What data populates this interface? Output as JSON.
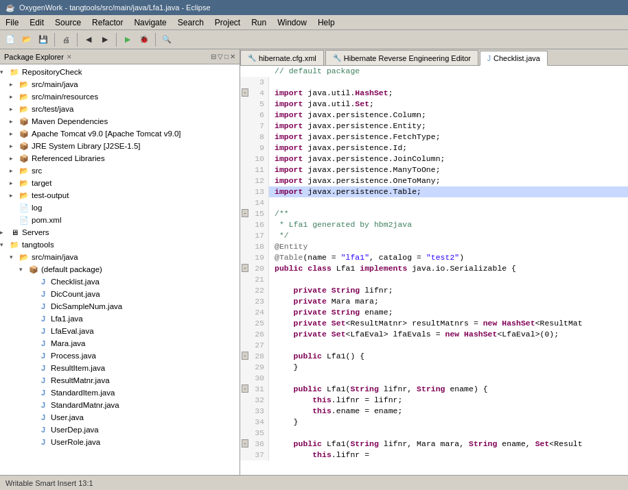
{
  "titleBar": {
    "title": "OxygenWork - tangtools/src/main/java/Lfa1.java - Eclipse",
    "icon": "☕"
  },
  "menuBar": {
    "items": [
      "File",
      "Edit",
      "Source",
      "Refactor",
      "Navigate",
      "Search",
      "Project",
      "Run",
      "Window",
      "Help"
    ]
  },
  "packageExplorer": {
    "header": "Package Explorer",
    "tree": [
      {
        "id": "repo-check",
        "label": "RepositoryCheck",
        "indent": 0,
        "type": "project",
        "expanded": true,
        "icon": "📁"
      },
      {
        "id": "src-main-java",
        "label": "src/main/java",
        "indent": 1,
        "type": "folder",
        "expanded": false,
        "icon": "📂"
      },
      {
        "id": "src-main-res",
        "label": "src/main/resources",
        "indent": 1,
        "type": "folder",
        "expanded": false,
        "icon": "📂"
      },
      {
        "id": "src-test-java",
        "label": "src/test/java",
        "indent": 1,
        "type": "folder",
        "expanded": false,
        "icon": "📂"
      },
      {
        "id": "maven-deps",
        "label": "Maven Dependencies",
        "indent": 1,
        "type": "lib",
        "expanded": false,
        "icon": "📦"
      },
      {
        "id": "tomcat",
        "label": "Apache Tomcat v9.0 [Apache Tomcat v9.0]",
        "indent": 1,
        "type": "lib",
        "expanded": false,
        "icon": "📦"
      },
      {
        "id": "jre",
        "label": "JRE System Library [J2SE-1.5]",
        "indent": 1,
        "type": "lib",
        "expanded": false,
        "icon": "📦"
      },
      {
        "id": "ref-libs",
        "label": "Referenced Libraries",
        "indent": 1,
        "type": "lib",
        "expanded": false,
        "icon": "📦"
      },
      {
        "id": "src",
        "label": "src",
        "indent": 1,
        "type": "folder",
        "expanded": false,
        "icon": "📂"
      },
      {
        "id": "target",
        "label": "target",
        "indent": 1,
        "type": "folder",
        "expanded": false,
        "icon": "📂"
      },
      {
        "id": "test-output",
        "label": "test-output",
        "indent": 1,
        "type": "folder",
        "expanded": false,
        "icon": "📂"
      },
      {
        "id": "log",
        "label": "log",
        "indent": 1,
        "type": "file",
        "icon": "📄"
      },
      {
        "id": "pom",
        "label": "pom.xml",
        "indent": 1,
        "type": "file",
        "icon": "📄"
      },
      {
        "id": "servers",
        "label": "Servers",
        "indent": 0,
        "type": "project",
        "expanded": false,
        "icon": "🖥"
      },
      {
        "id": "tangtools",
        "label": "tangtools",
        "indent": 0,
        "type": "project",
        "expanded": true,
        "icon": "📁"
      },
      {
        "id": "tang-src-main-java",
        "label": "src/main/java",
        "indent": 1,
        "type": "folder",
        "expanded": true,
        "icon": "📂"
      },
      {
        "id": "tang-default-pkg",
        "label": "(default package)",
        "indent": 2,
        "type": "package",
        "expanded": true,
        "icon": "📦"
      },
      {
        "id": "Checklist",
        "label": "Checklist.java",
        "indent": 3,
        "type": "java",
        "icon": "J"
      },
      {
        "id": "DicCount",
        "label": "DicCount.java",
        "indent": 3,
        "type": "java",
        "icon": "J"
      },
      {
        "id": "DicSampleNum",
        "label": "DicSampleNum.java",
        "indent": 3,
        "type": "java",
        "icon": "J"
      },
      {
        "id": "Lfa1",
        "label": "Lfa1.java",
        "indent": 3,
        "type": "java",
        "icon": "J"
      },
      {
        "id": "LfaEval",
        "label": "LfaEval.java",
        "indent": 3,
        "type": "java",
        "icon": "J"
      },
      {
        "id": "Mara",
        "label": "Mara.java",
        "indent": 3,
        "type": "java",
        "icon": "J"
      },
      {
        "id": "Process",
        "label": "Process.java",
        "indent": 3,
        "type": "java",
        "icon": "J"
      },
      {
        "id": "ResultItem",
        "label": "ResultItem.java",
        "indent": 3,
        "type": "java",
        "icon": "J"
      },
      {
        "id": "ResultMatnr",
        "label": "ResultMatnr.java",
        "indent": 3,
        "type": "java",
        "icon": "J"
      },
      {
        "id": "StandardItem",
        "label": "StandardItem.java",
        "indent": 3,
        "type": "java",
        "icon": "J"
      },
      {
        "id": "StandardMatnr",
        "label": "StandardMatnr.java",
        "indent": 3,
        "type": "java",
        "icon": "J"
      },
      {
        "id": "User",
        "label": "User.java",
        "indent": 3,
        "type": "java",
        "icon": "J"
      },
      {
        "id": "UserDep",
        "label": "UserDep.java",
        "indent": 3,
        "type": "java",
        "icon": "J"
      },
      {
        "id": "UserRole",
        "label": "UserRole.java",
        "indent": 3,
        "type": "java",
        "icon": "J"
      }
    ]
  },
  "editorTabs": [
    {
      "id": "hibernate-cfg",
      "label": "hibernate.cfg.xml",
      "active": false,
      "icon": "🔧"
    },
    {
      "id": "hibernate-rev",
      "label": "Hibernate Reverse Engineering Editor",
      "active": false,
      "icon": "🔧"
    },
    {
      "id": "checklist-java",
      "label": "Checklist.java",
      "active": true,
      "icon": "J"
    }
  ],
  "codeLines": [
    {
      "num": "",
      "content": "// default package",
      "fold": false,
      "foldType": "",
      "highlighted": false
    },
    {
      "num": "3",
      "content": "",
      "fold": false,
      "foldType": "",
      "highlighted": false
    },
    {
      "num": "4",
      "content": "import java.util.HashSet;",
      "fold": true,
      "foldType": "-",
      "highlighted": false
    },
    {
      "num": "5",
      "content": "import java.util.Set;",
      "fold": false,
      "foldType": "",
      "highlighted": false
    },
    {
      "num": "6",
      "content": "import javax.persistence.Column;",
      "fold": false,
      "foldType": "",
      "highlighted": false
    },
    {
      "num": "7",
      "content": "import javax.persistence.Entity;",
      "fold": false,
      "foldType": "",
      "highlighted": false
    },
    {
      "num": "8",
      "content": "import javax.persistence.FetchType;",
      "fold": false,
      "foldType": "",
      "highlighted": false
    },
    {
      "num": "9",
      "content": "import javax.persistence.Id;",
      "fold": false,
      "foldType": "",
      "highlighted": false
    },
    {
      "num": "10",
      "content": "import javax.persistence.JoinColumn;",
      "fold": false,
      "foldType": "",
      "highlighted": false
    },
    {
      "num": "11",
      "content": "import javax.persistence.ManyToOne;",
      "fold": false,
      "foldType": "",
      "highlighted": false
    },
    {
      "num": "12",
      "content": "import javax.persistence.OneToMany;",
      "fold": false,
      "foldType": "",
      "highlighted": false
    },
    {
      "num": "13",
      "content": "import javax.persistence.Table;",
      "fold": false,
      "foldType": "",
      "highlighted": true
    },
    {
      "num": "14",
      "content": "",
      "fold": false,
      "foldType": "",
      "highlighted": false
    },
    {
      "num": "15",
      "content": "/**",
      "fold": true,
      "foldType": "-",
      "highlighted": false
    },
    {
      "num": "16",
      "content": " * Lfa1 generated by hbm2java",
      "fold": false,
      "foldType": "",
      "highlighted": false
    },
    {
      "num": "17",
      "content": " */",
      "fold": false,
      "foldType": "",
      "highlighted": false
    },
    {
      "num": "18",
      "content": "@Entity",
      "fold": false,
      "foldType": "",
      "highlighted": false
    },
    {
      "num": "19",
      "content": "@Table(name = \"lfa1\", catalog = \"test2\")",
      "fold": false,
      "foldType": "",
      "highlighted": false
    },
    {
      "num": "20",
      "content": "public class Lfa1 implements java.io.Serializable {",
      "fold": true,
      "foldType": "-",
      "highlighted": false
    },
    {
      "num": "21",
      "content": "",
      "fold": false,
      "foldType": "",
      "highlighted": false
    },
    {
      "num": "22",
      "content": "    private String lifnr;",
      "fold": false,
      "foldType": "",
      "highlighted": false
    },
    {
      "num": "23",
      "content": "    private Mara mara;",
      "fold": false,
      "foldType": "",
      "highlighted": false
    },
    {
      "num": "24",
      "content": "    private String ename;",
      "fold": false,
      "foldType": "",
      "highlighted": false
    },
    {
      "num": "25",
      "content": "    private Set<ResultMatnr> resultMatnrs = new HashSet<ResultMat",
      "fold": false,
      "foldType": "",
      "highlighted": false
    },
    {
      "num": "26",
      "content": "    private Set<LfaEval> lfaEvals = new HashSet<LfaEval>(0);",
      "fold": false,
      "foldType": "",
      "highlighted": false
    },
    {
      "num": "27",
      "content": "",
      "fold": false,
      "foldType": "",
      "highlighted": false
    },
    {
      "num": "28",
      "content": "    public Lfa1() {",
      "fold": true,
      "foldType": "-",
      "highlighted": false
    },
    {
      "num": "29",
      "content": "    }",
      "fold": false,
      "foldType": "",
      "highlighted": false
    },
    {
      "num": "30",
      "content": "",
      "fold": false,
      "foldType": "",
      "highlighted": false
    },
    {
      "num": "31",
      "content": "    public Lfa1(String lifnr, String ename) {",
      "fold": true,
      "foldType": "-",
      "highlighted": false
    },
    {
      "num": "32",
      "content": "        this.lifnr = lifnr;",
      "fold": false,
      "foldType": "",
      "highlighted": false
    },
    {
      "num": "33",
      "content": "        this.ename = ename;",
      "fold": false,
      "foldType": "",
      "highlighted": false
    },
    {
      "num": "34",
      "content": "    }",
      "fold": false,
      "foldType": "",
      "highlighted": false
    },
    {
      "num": "35",
      "content": "",
      "fold": false,
      "foldType": "",
      "highlighted": false
    },
    {
      "num": "36",
      "content": "    public Lfa1(String lifnr, Mara mara, String ename, Set<Result",
      "fold": true,
      "foldType": "-",
      "highlighted": false
    },
    {
      "num": "37",
      "content": "        this.lifnr =",
      "fold": false,
      "foldType": "",
      "highlighted": false
    }
  ],
  "statusBar": {
    "text": "Writable  Smart Insert  13:1"
  },
  "colors": {
    "keyword": "#7f0055",
    "comment": "#3f7f5f",
    "string": "#2a00ff",
    "annotation": "#646464",
    "highlight": "#c8d8ff",
    "accent": "#3399ff"
  }
}
